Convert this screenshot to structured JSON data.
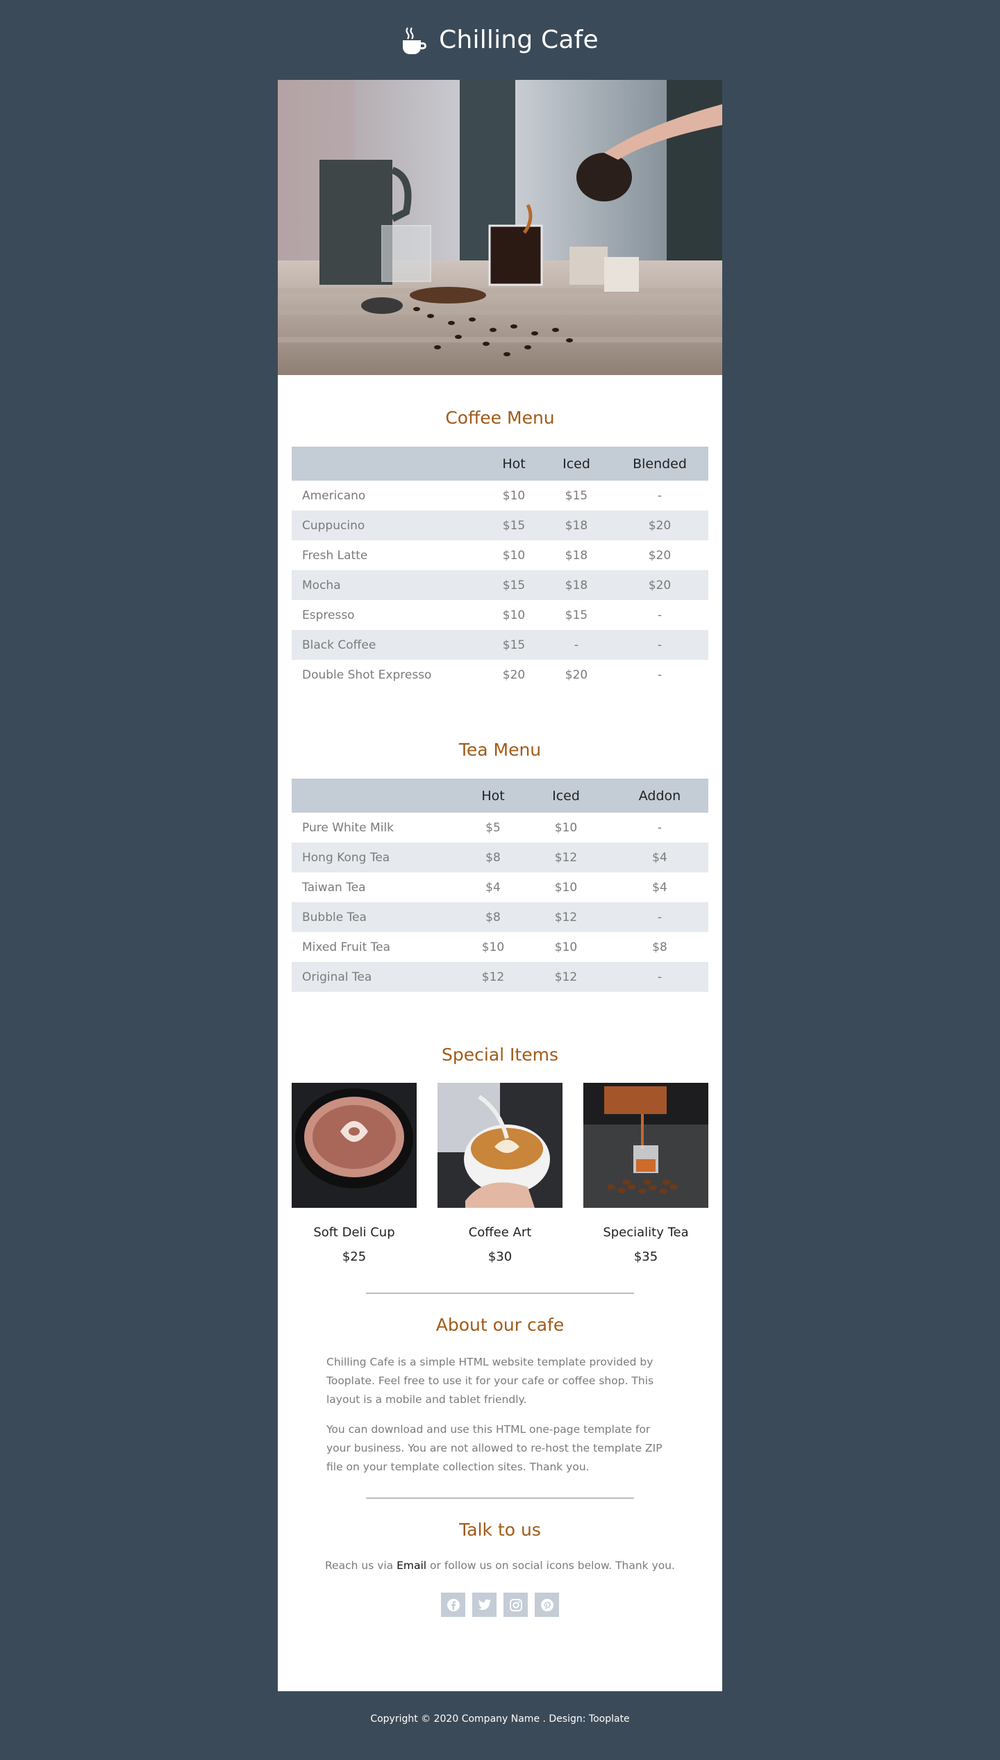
{
  "site": {
    "title": "Chilling Cafe",
    "logo_icon": "coffee-cup-icon"
  },
  "coffee_menu": {
    "title": "Coffee Menu",
    "headers": [
      "",
      "Hot",
      "Iced",
      "Blended"
    ],
    "rows": [
      [
        "Americano",
        "$10",
        "$15",
        "-"
      ],
      [
        "Cuppucino",
        "$15",
        "$18",
        "$20"
      ],
      [
        "Fresh Latte",
        "$10",
        "$18",
        "$20"
      ],
      [
        "Mocha",
        "$15",
        "$18",
        "$20"
      ],
      [
        "Espresso",
        "$10",
        "$15",
        "-"
      ],
      [
        "Black Coffee",
        "$15",
        "-",
        "-"
      ],
      [
        "Double Shot Expresso",
        "$20",
        "$20",
        "-"
      ]
    ]
  },
  "tea_menu": {
    "title": "Tea Menu",
    "headers": [
      "",
      "Hot",
      "Iced",
      "Addon"
    ],
    "rows": [
      [
        "Pure White Milk",
        "$5",
        "$10",
        "-"
      ],
      [
        "Hong Kong Tea",
        "$8",
        "$12",
        "$4"
      ],
      [
        "Taiwan Tea",
        "$4",
        "$10",
        "$4"
      ],
      [
        "Bubble Tea",
        "$8",
        "$12",
        "-"
      ],
      [
        "Mixed Fruit Tea",
        "$10",
        "$10",
        "$8"
      ],
      [
        "Original Tea",
        "$12",
        "$12",
        "-"
      ]
    ]
  },
  "specials": {
    "title": "Special Items",
    "items": [
      {
        "name": "Soft Deli Cup",
        "price": "$25"
      },
      {
        "name": "Coffee Art",
        "price": "$30"
      },
      {
        "name": "Speciality Tea",
        "price": "$35"
      }
    ]
  },
  "about": {
    "title": "About our cafe",
    "paragraphs": [
      "Chilling Cafe is a simple HTML website template provided by Tooplate. Feel free to use it for your cafe or coffee shop. This layout is a mobile and tablet friendly.",
      "You can download and use this HTML one-page template for your business. You are not allowed to re-host the template ZIP file on your template collection sites. Thank you."
    ]
  },
  "talk": {
    "title": "Talk to us",
    "prefix": "Reach us via ",
    "email_label": "Email",
    "suffix": " or follow us on social icons below. Thank you.",
    "socials": [
      "facebook-icon",
      "twitter-icon",
      "instagram-icon",
      "pinterest-icon"
    ]
  },
  "footer": {
    "text": "Copyright © 2020 Company Name . Design: Tooplate"
  },
  "colors": {
    "page_bg": "#3b4a59",
    "accent": "#a15b18",
    "table_header": "#c4ccd6",
    "row_alt": "#e6e9ed"
  }
}
